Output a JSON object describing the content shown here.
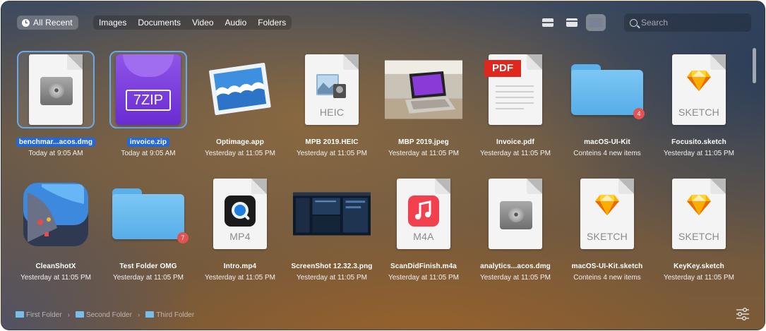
{
  "toolbar": {
    "recent_label": "All Recent",
    "filters": [
      "Images",
      "Documents",
      "Video",
      "Audio",
      "Folders"
    ],
    "search_placeholder": "Search"
  },
  "items": [
    {
      "name": "benchmar...acos.dmg",
      "date": "Today at 9:05 AM",
      "icon": "disk-image-icon",
      "selected": true
    },
    {
      "name": "invoice.zip",
      "date": "Today at 9:05 AM",
      "icon": "zip-archive-icon",
      "label": "7ZIP",
      "selected": true
    },
    {
      "name": "Optimage.app",
      "date": "Yesterday at 11:05 PM",
      "icon": "optimage-app-icon"
    },
    {
      "name": "MPB 2019.HEIC",
      "date": "Yesterday at 11:05 PM",
      "icon": "heic-file-icon",
      "label": "HEIC"
    },
    {
      "name": "MBP 2019.jpeg",
      "date": "Yesterday at 11:05 PM",
      "icon": "photo-thumbnail"
    },
    {
      "name": "Invoice.pdf",
      "date": "Yesterday at 11:05 PM",
      "icon": "pdf-file-icon",
      "label": "PDF"
    },
    {
      "name": "macOS-UI-Kit",
      "date": "Conteins 4 new items",
      "icon": "folder-icon",
      "badge": "4"
    },
    {
      "name": "Focusito.sketch",
      "date": "Yesterday at 11:05 PM",
      "icon": "sketch-file-icon",
      "label": "SKETCH"
    },
    {
      "name": "CleanShotX",
      "date": "Yesterday at 11:05 PM",
      "icon": "cleanshot-app-icon"
    },
    {
      "name": "Test Folder OMG",
      "date": "Yesterday at 11:05 PM",
      "icon": "folder-icon",
      "badge": "7"
    },
    {
      "name": "Intro.mp4",
      "date": "Yesterday at 11:05 PM",
      "icon": "mp4-file-icon",
      "label": "MP4"
    },
    {
      "name": "ScreenShot 12.32.3.png",
      "date": "Yesterday at 11:05 PM",
      "icon": "screenshot-thumbnail"
    },
    {
      "name": "ScanDidFinish.m4a",
      "date": "Yesterday at 11:05 PM",
      "icon": "m4a-file-icon",
      "label": "M4A"
    },
    {
      "name": "analytics...acos.dmg",
      "date": "Yesterday at 11:05 PM",
      "icon": "disk-image-icon"
    },
    {
      "name": "macOS-UI-Kit.sketch",
      "date": "Conteins 4 new items",
      "icon": "sketch-file-icon",
      "label": "SKETCH"
    },
    {
      "name": "KeyKey.sketch",
      "date": "Yesterday at 11:05 PM",
      "icon": "sketch-file-icon",
      "label": "SKETCH"
    }
  ],
  "breadcrumb": [
    "First Folder",
    "Second Folder",
    "Third Folder"
  ],
  "colors": {
    "selection": "#2468d6",
    "selection_border": "#6aa9e6",
    "badge": "#e45252",
    "folder": "#6bbcf0"
  }
}
